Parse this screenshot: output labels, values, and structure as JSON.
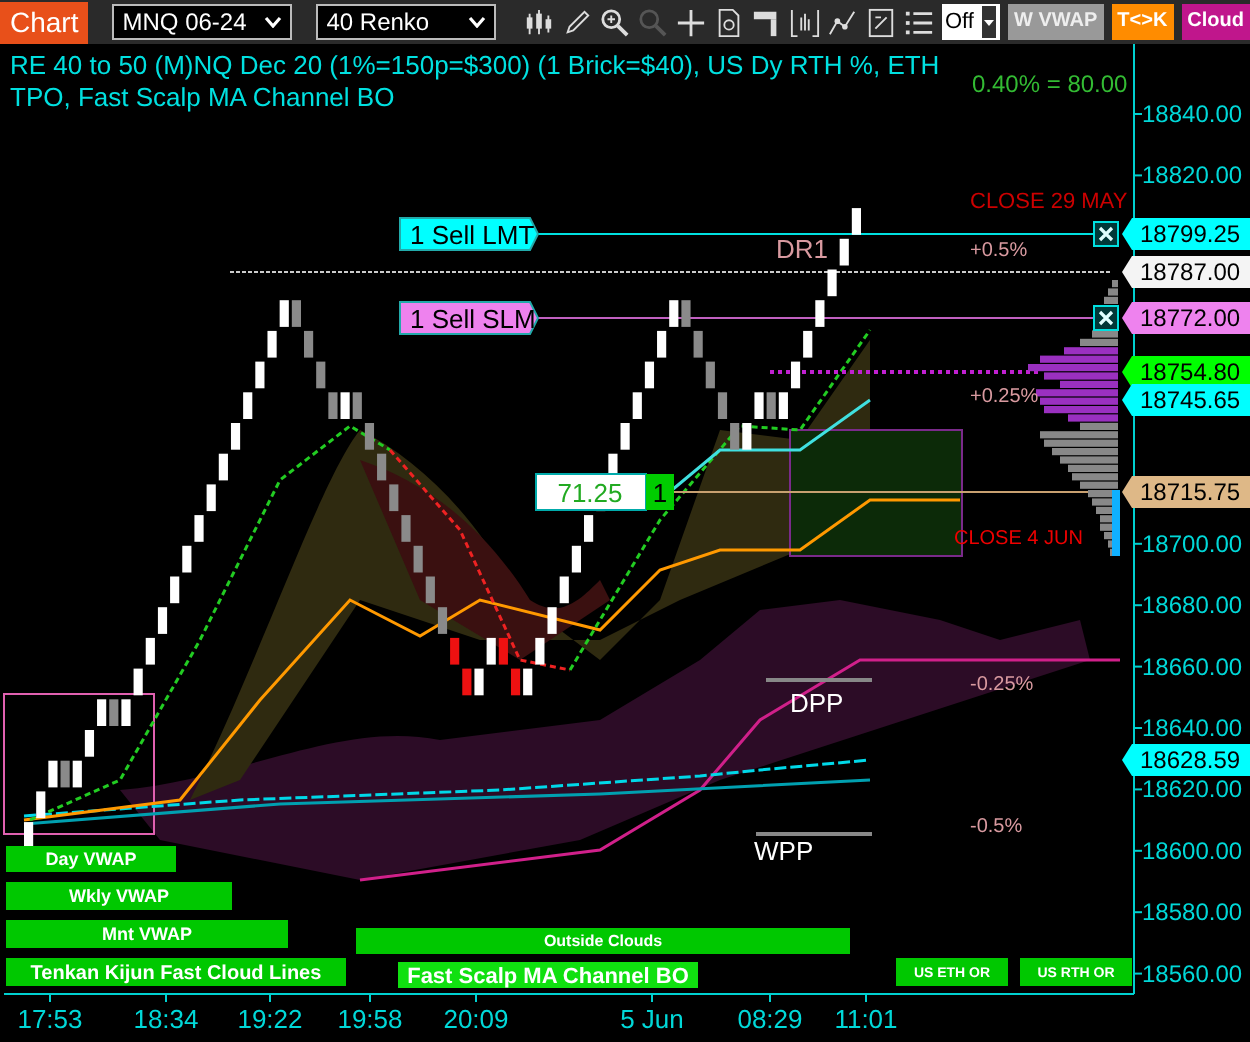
{
  "toolbar": {
    "tab": "Chart",
    "instrument": "MNQ 06-24",
    "bar_type": "40 Renko",
    "mode_select": "Off",
    "buttons": [
      {
        "label": "W VWAP",
        "kind": "grey"
      },
      {
        "label": "T<>K",
        "kind": "orange"
      },
      {
        "label": "Cloud",
        "kind": "magenta"
      }
    ]
  },
  "chart": {
    "title": "RE 40 to 50 (M)NQ Dec 20 (1%=150p=$300) (1 Brick=$40), US Dy RTH %, ETH TPO, Fast Scalp MA Channel BO",
    "scale_note": "0.40% = 80.00",
    "price_axis": [
      "18840.00",
      "18820.00",
      "18700.00",
      "18680.00",
      "18660.00",
      "18640.00",
      "18620.00",
      "18600.00",
      "18580.00",
      "18560.00"
    ],
    "time_axis": [
      "17:53",
      "18:34",
      "19:22",
      "19:58",
      "20:09",
      "5 Jun",
      "08:29",
      "11:01"
    ],
    "price_tags": [
      {
        "value": "18799.25",
        "color": "#00ffff"
      },
      {
        "value": "18787.00",
        "color": "#f4f4f4"
      },
      {
        "value": "18772.00",
        "color": "#ee82ee"
      },
      {
        "value": "18754.80",
        "color": "#00ff00"
      },
      {
        "value": "18745.65",
        "color": "#00ffff"
      },
      {
        "value": "18715.75",
        "color": "#deb887"
      },
      {
        "value": "18628.59",
        "color": "#00ffff"
      }
    ],
    "order_tags": [
      {
        "label": "1 Sell LMT",
        "color": "#00ffff"
      },
      {
        "label": "1 Sell SLM",
        "color": "#ee82ee"
      }
    ],
    "position": {
      "pnl": "71.25",
      "quantity": "1"
    },
    "level_labels": [
      {
        "text": "CLOSE 29 MAY",
        "color": "#cc0000"
      },
      {
        "text": "+0.5%",
        "color": "#d99aa0"
      },
      {
        "text": "DR1",
        "color": "#d99aa0"
      },
      {
        "text": "+0.25%",
        "color": "#d99aa0"
      },
      {
        "text": "CLOSE 4 JUN",
        "color": "#ee0000"
      },
      {
        "text": "-0.25%",
        "color": "#d99aa0"
      },
      {
        "text": "DPP",
        "color": "#ffffff"
      },
      {
        "text": "-0.5%",
        "color": "#d99aa0"
      },
      {
        "text": "WPP",
        "color": "#ffffff"
      }
    ],
    "indicator_labels": [
      "Day VWAP",
      "Wkly VWAP",
      "Mnt VWAP",
      "Outside Clouds",
      "Tenkan Kijun Fast Cloud Lines",
      "Fast Scalp MA Channel BO",
      "US ETH OR",
      "US RTH OR"
    ]
  }
}
